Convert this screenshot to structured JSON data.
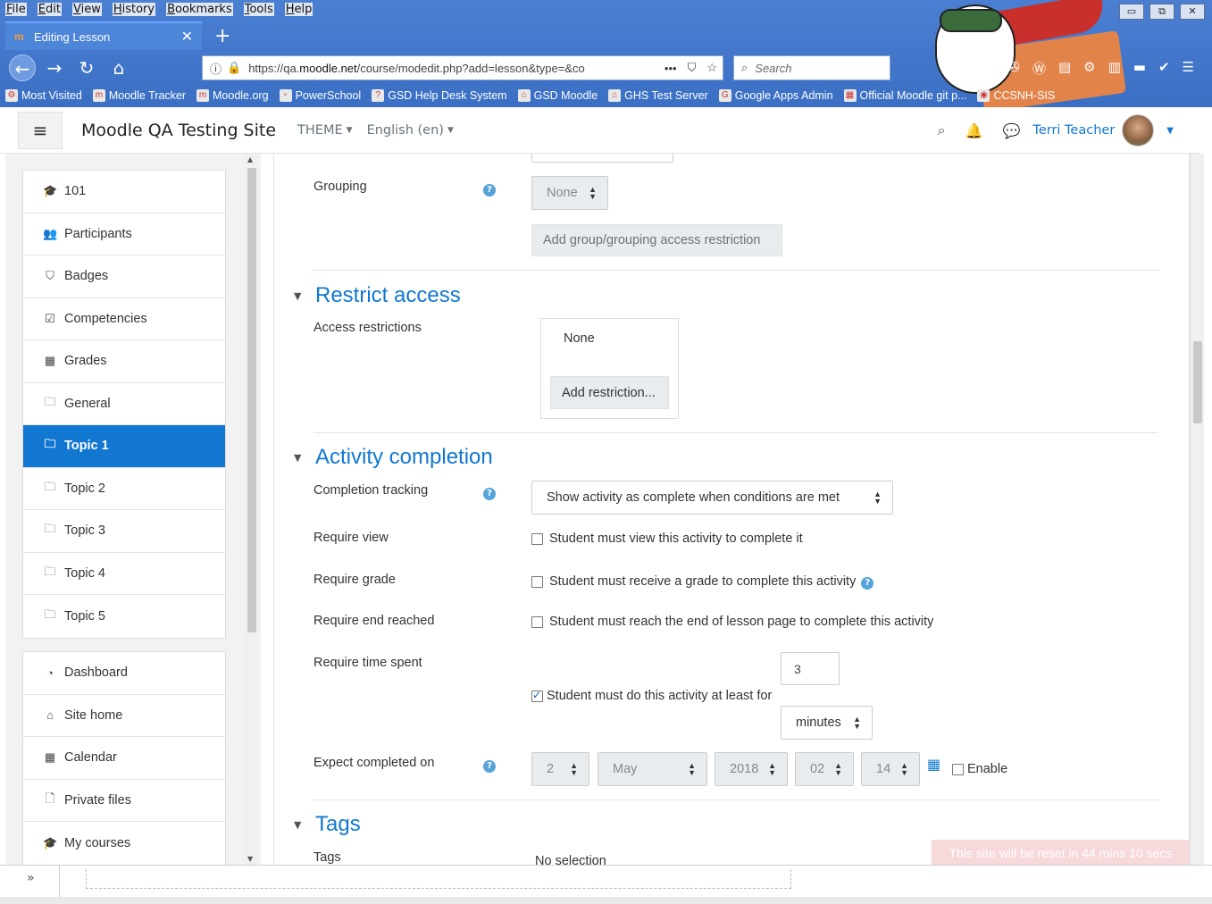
{
  "browser": {
    "menu": [
      "File",
      "Edit",
      "View",
      "History",
      "Bookmarks",
      "Tools",
      "Help"
    ],
    "tab_title": "Editing Lesson",
    "url_prefix": "https://qa.",
    "url_domain": "moodle.net",
    "url_path": "/course/modedit.php?add=lesson&type=&co",
    "search_placeholder": "Search",
    "bookmarks": [
      "Most Visited",
      "Moodle Tracker",
      "Moodle.org",
      "PowerSchool",
      "GSD Help Desk System",
      "GSD Moodle",
      "GHS Test Server",
      "Google Apps Admin",
      "Official Moodle git p...",
      "CCSNH-SIS"
    ]
  },
  "header": {
    "site_name": "Moodle QA Testing Site",
    "theme_menu": "THEME",
    "language_menu": "English (en)",
    "user_name": "Terri Teacher"
  },
  "nav": {
    "course_items": [
      {
        "icon": "graduation-cap-icon",
        "glyph": "🎓",
        "label": "101"
      },
      {
        "icon": "users-icon",
        "glyph": "👥",
        "label": "Participants"
      },
      {
        "icon": "shield-icon",
        "glyph": "⛉",
        "label": "Badges"
      },
      {
        "icon": "check-square-icon",
        "glyph": "☑",
        "label": "Competencies"
      },
      {
        "icon": "table-icon",
        "glyph": "▦",
        "label": "Grades"
      },
      {
        "icon": "folder-icon",
        "glyph": "🗀",
        "label": "General"
      },
      {
        "icon": "folder-icon",
        "glyph": "🗀",
        "label": "Topic 1",
        "active": true
      },
      {
        "icon": "folder-icon",
        "glyph": "🗀",
        "label": "Topic 2"
      },
      {
        "icon": "folder-icon",
        "glyph": "🗀",
        "label": "Topic 3"
      },
      {
        "icon": "folder-icon",
        "glyph": "🗀",
        "label": "Topic 4"
      },
      {
        "icon": "folder-icon",
        "glyph": "🗀",
        "label": "Topic 5"
      }
    ],
    "site_items": [
      {
        "icon": "dashboard-icon",
        "glyph": "◔",
        "label": "Dashboard"
      },
      {
        "icon": "home-icon",
        "glyph": "⌂",
        "label": "Site home"
      },
      {
        "icon": "calendar-icon",
        "glyph": "▦",
        "label": "Calendar"
      },
      {
        "icon": "file-icon",
        "glyph": "🗋",
        "label": "Private files"
      },
      {
        "icon": "graduation-cap-icon",
        "glyph": "🎓",
        "label": "My courses"
      }
    ]
  },
  "form": {
    "grouping_label": "Grouping",
    "grouping_value": "None",
    "add_group_restriction_button": "Add group/grouping access restriction",
    "restrict_access": {
      "title": "Restrict access",
      "access_restrictions_label": "Access restrictions",
      "value": "None",
      "add_restriction_button": "Add restriction..."
    },
    "activity_completion": {
      "title": "Activity completion",
      "completion_tracking_label": "Completion tracking",
      "completion_tracking_value": "Show activity as complete when conditions are met",
      "require_view_label": "Require view",
      "require_view_text": "Student must view this activity to complete it",
      "require_view_checked": false,
      "require_grade_label": "Require grade",
      "require_grade_text": "Student must receive a grade to complete this activity",
      "require_grade_checked": false,
      "require_end_label": "Require end reached",
      "require_end_text": "Student must reach the end of lesson page to complete this activity",
      "require_end_checked": false,
      "require_time_label": "Require time spent",
      "require_time_value": "3",
      "require_time_text": "Student must do this activity at least for",
      "require_time_checked": true,
      "require_time_unit": "minutes",
      "expect_completed_label": "Expect completed on",
      "expect_day": "2",
      "expect_month": "May",
      "expect_year": "2018",
      "expect_hour": "02",
      "expect_minute": "14",
      "enable_label": "Enable"
    },
    "tags": {
      "title": "Tags",
      "tags_label": "Tags",
      "tags_value": "No selection"
    }
  },
  "toast": "This site will be reset in 44 mins 10 secs",
  "colors": {
    "brand": "#1177d1",
    "chrome": "#3a6fc4"
  }
}
